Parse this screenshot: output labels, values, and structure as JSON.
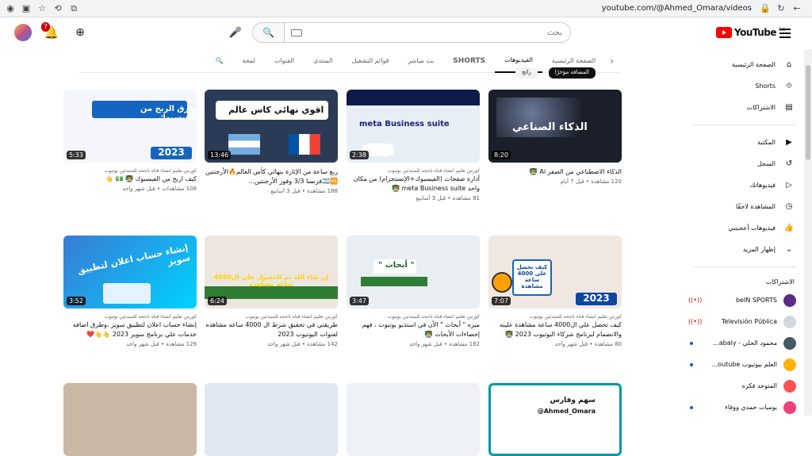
{
  "browser": {
    "url": "youtube.com/@Ahmed_Omara/videos"
  },
  "header": {
    "notification_count": "7",
    "search_placeholder": "بحث",
    "logo_text": "YouTube",
    "region": "EG"
  },
  "tabs": [
    {
      "label": "الصفحة الرئيسية",
      "active": false
    },
    {
      "label": "الفيديوهات",
      "active": true
    },
    {
      "label": "SHORTS",
      "active": false
    },
    {
      "label": "بث مباشر",
      "active": false
    },
    {
      "label": "قوائم التشغيل",
      "active": false
    },
    {
      "label": "المنتدى",
      "active": false
    },
    {
      "label": "القنوات",
      "active": false
    },
    {
      "label": "لمحة",
      "active": false
    }
  ],
  "videos": [
    {
      "title": "الذكاء الاصطناعي من الصفر Ai 👨‍🏫",
      "channel": "",
      "views": "120 مشاهدة",
      "age": "قبل 7 أيام",
      "duration": "8:20",
      "thumb_text": "الذكاء الصناعي",
      "bg": "#1b1f2a",
      "fg": "#ffffff"
    },
    {
      "title": "أدارة صفحات (الفيسبوك+الإنستجرام) من مكان واحد meta Business suite 👨‍🏫",
      "channel": "كورس تعليم انشاء قناه ناجحه للمبتدئين يوتيوب",
      "views": "81 مشاهدة",
      "age": "قبل 3 أسابيع",
      "duration": "2:38",
      "thumb_text": "meta Business suite",
      "bg": "#e8eef6",
      "fg": "#1a237e"
    },
    {
      "title": "ربع ساعة من الإثارة بنهائي كأس العالم🔥الأرجنتين🇦🇷🆚فرنسا 3/3 وفوز الأرجنتين...",
      "channel": "كورس تعليم انشاء قناه ناجحه للمبتدئين يوتيوب",
      "views": "188 مشاهدة",
      "age": "قبل 3 أسابيع",
      "duration": "13:46",
      "thumb_text": "اقوي نهائي كاس عالم",
      "bg": "#2b3b55",
      "fg": "#ffd600"
    },
    {
      "title": "كيف اربح من الفيسبوك 👨‍🏫 💵 👆",
      "channel": "كورس تعليم انشاء قناه ناجحه للمبتدئين يوتيوب",
      "views": "108 مشاهدات",
      "age": "قبل شهر واحد",
      "duration": "5:33",
      "thumb_text": "طرق الربح من الفيسبوك",
      "bg": "#f4f6fb",
      "fg": "#ffffff"
    },
    {
      "title": "كيف تحصل علي ال4000 ساعة مشاهدة علينه والانضمام لبرنامج شركاء اليوتيوب 2023 👨‍🏫",
      "channel": "كورس تعليم انشاء قناه ناجحه للمبتدئين يوتيوب",
      "views": "80 مشاهدة",
      "age": "قبل شهر واحد",
      "duration": "7:07",
      "thumb_text": "كيف تحصل علي 4000 ساعة مشاهدة",
      "bg": "#f1e7e1",
      "fg": "#0d47a1"
    },
    {
      "title": "ميزه \" أبحاث \" الأن في استديو يوتيوب ، فهم إحصاءات الأبحاث 👨‍🏫",
      "channel": "كورس تعليم انشاء قناه ناجحه للمبتدئين يوتيوب",
      "views": "182 مشاهدة",
      "age": "قبل شهر واحد",
      "duration": "3:47",
      "thumb_text": "\" أبحاث \"",
      "bg": "#e9eef2",
      "fg": "#1b5e20"
    },
    {
      "title": "طريقتي في تحقيق شرط ال 4000 ساعه مشاهده لقنوات اليوتيوب 2023",
      "channel": "كورس تعليم انشاء قناه ناجحه للمبتدئين يوتيوب",
      "views": "142 مشاهدة",
      "age": "قبل شهر واحد",
      "duration": "6:24",
      "thumb_text": "إن شاء الله تم الحصول علي ال4000 ساعه مشاهده",
      "bg": "#ede6df",
      "fg": "#ffd600"
    },
    {
      "title": "إنشاء حساب اعلان لتطبيق سويز ،وطرق اضافه خدمات علي برنامج سويز 2023 👆👆❤️",
      "channel": "كورس تعليم انشاء قناه ناجحه للمبتدئين يوتيوب",
      "views": "129 مشاهدة",
      "age": "قبل شهر واحد",
      "duration": "3:52",
      "thumb_text": "إنشاء حساب اعلان لتطبيق سويز",
      "bg": "#3a7bd5",
      "fg": "#ffffff"
    }
  ],
  "bottom_row": [
    {
      "thumb_text": "سهم وفارس",
      "sub": "@Ahmed_Omara"
    }
  ],
  "sidebar": {
    "main": [
      {
        "label": "الصفحة الرئيسية",
        "icon": "home-icon"
      },
      {
        "label": "Shorts",
        "icon": "shorts-icon"
      },
      {
        "label": "الاشتراكات",
        "icon": "subscriptions-icon"
      }
    ],
    "library": [
      {
        "label": "المكتبة",
        "icon": "library-icon"
      },
      {
        "label": "السجل",
        "icon": "history-icon"
      },
      {
        "label": "فيديوهاتك",
        "icon": "your-videos-icon"
      },
      {
        "label": "المشاهدة لاحقًا",
        "icon": "watch-later-icon"
      },
      {
        "label": "فيديوهات أعجبتني",
        "icon": "liked-icon"
      },
      {
        "label": "إظهار المزيد",
        "icon": "chevron-down-icon"
      }
    ],
    "subs_heading": "الاشتراكات",
    "subs": [
      {
        "name": "beIN SPORTS",
        "live": true,
        "color": "#5a2d82"
      },
      {
        "name": "Televisión Pública",
        "live": true,
        "color": "#cfd8dc"
      },
      {
        "name": "محمود الحلي - abaly...",
        "live": false,
        "dot": true,
        "color": "#455a64"
      },
      {
        "name": "العلم بيوتيوب outube...",
        "live": false,
        "dot": true,
        "color": "#ffb300"
      },
      {
        "name": "المتوحد فكره",
        "live": false,
        "dot": false,
        "color": "#ff5252"
      },
      {
        "name": "يوميات حمدي ووفاء",
        "live": false,
        "dot": true,
        "color": "#ec407a"
      }
    ]
  },
  "sort_chips": [
    "المضافة مؤخرًا",
    "رائج"
  ]
}
